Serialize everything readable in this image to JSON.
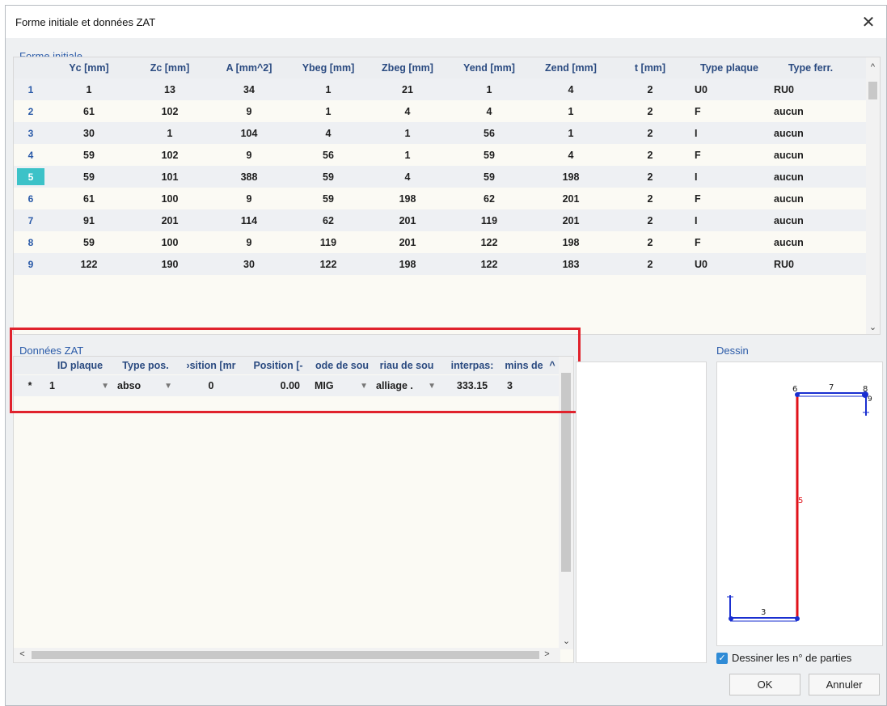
{
  "window": {
    "title": "Forme initiale et données ZAT",
    "close_glyph": "✕"
  },
  "forme": {
    "label": "Forme initiale",
    "headers": [
      "",
      "Yc [mm]",
      "Zc [mm]",
      "A [mm^2]",
      "Ybeg [mm]",
      "Zbeg [mm]",
      "Yend [mm]",
      "Zend [mm]",
      "t [mm]",
      "Type plaque",
      "Type ferr."
    ],
    "rows": [
      [
        "1",
        "1",
        "13",
        "34",
        "1",
        "21",
        "1",
        "4",
        "2",
        "U0",
        "RU0"
      ],
      [
        "2",
        "61",
        "102",
        "9",
        "1",
        "4",
        "4",
        "1",
        "2",
        "F",
        "aucun"
      ],
      [
        "3",
        "30",
        "1",
        "104",
        "4",
        "1",
        "56",
        "1",
        "2",
        "I",
        "aucun"
      ],
      [
        "4",
        "59",
        "102",
        "9",
        "56",
        "1",
        "59",
        "4",
        "2",
        "F",
        "aucun"
      ],
      [
        "5",
        "59",
        "101",
        "388",
        "59",
        "4",
        "59",
        "198",
        "2",
        "I",
        "aucun"
      ],
      [
        "6",
        "61",
        "100",
        "9",
        "59",
        "198",
        "62",
        "201",
        "2",
        "F",
        "aucun"
      ],
      [
        "7",
        "91",
        "201",
        "114",
        "62",
        "201",
        "119",
        "201",
        "2",
        "I",
        "aucun"
      ],
      [
        "8",
        "59",
        "100",
        "9",
        "119",
        "201",
        "122",
        "198",
        "2",
        "F",
        "aucun"
      ],
      [
        "9",
        "122",
        "190",
        "30",
        "122",
        "198",
        "122",
        "183",
        "2",
        "U0",
        "RU0"
      ]
    ],
    "selected_row": "5"
  },
  "zat": {
    "label": "Données ZAT",
    "headers": [
      "",
      "ID plaque",
      "Type pos.",
      "›sition [mr",
      "Position [-",
      "ode de sou",
      "riau de sou",
      "interpas:",
      "mins de",
      "^"
    ],
    "row": {
      "marker": "*",
      "id_plaque": "1",
      "type_pos": "abso",
      "position_mm": "0",
      "position_rel": "0.00",
      "mode": "MIG",
      "materiau": "alliage .",
      "interpass": "333.15",
      "mins": "3"
    }
  },
  "dessin": {
    "label": "Dessin",
    "part_labels": {
      "p3": "3",
      "p5": "5",
      "p6": "6",
      "p7": "7",
      "p8": "8",
      "p9": "9"
    }
  },
  "checkbox": {
    "label": "Dessiner les n° de parties",
    "checked": true
  },
  "buttons": {
    "ok": "OK",
    "cancel": "Annuler"
  },
  "colors": {
    "selection": "#3cc2c8",
    "highlight": "#e0222c",
    "section_blue": "#1a2fd0",
    "section_red": "#e0121a"
  }
}
